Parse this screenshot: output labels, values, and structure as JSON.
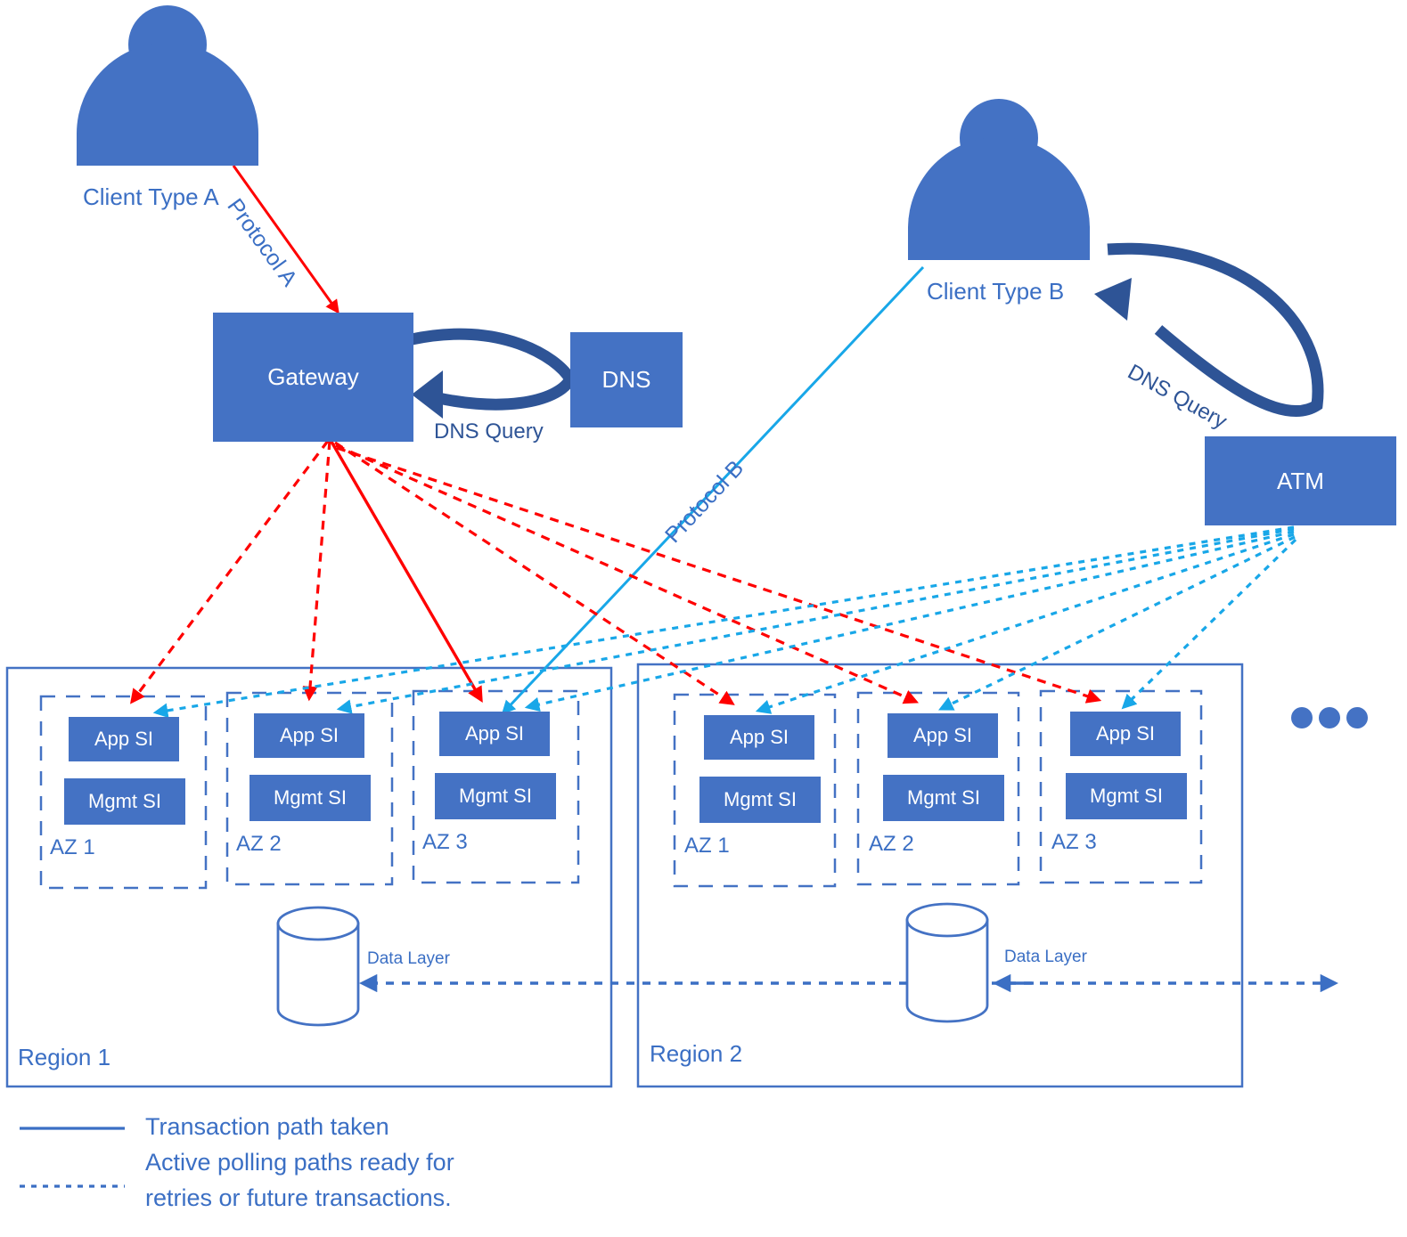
{
  "colors": {
    "brand_blue": "#4472C4",
    "label_blue": "#3B6FC4",
    "navy": "#2E5496",
    "red_path": "#FF0000",
    "cyan_path": "#18A7E8",
    "outline_blue": "#4472C4"
  },
  "actors": [
    {
      "name": "client-type-a",
      "label": "Client Type A"
    },
    {
      "name": "client-type-b",
      "label": "Client Type B"
    }
  ],
  "nodes": {
    "gateway": "Gateway",
    "dns": "DNS",
    "atm": "ATM"
  },
  "edge_labels": {
    "protocol_a": "Protocol A",
    "protocol_b": "Protocol B",
    "dns_query_gateway": "DNS Query",
    "dns_query_atm": "DNS Query",
    "data_layer_region1": "Data Layer",
    "data_layer_region2": "Data Layer"
  },
  "regions": [
    {
      "name": "region-1",
      "label": "Region 1",
      "azs": [
        {
          "label": "AZ 1",
          "app": "App SI",
          "mgmt": "Mgmt SI"
        },
        {
          "label": "AZ 2",
          "app": "App SI",
          "mgmt": "Mgmt SI"
        },
        {
          "label": "AZ 3",
          "app": "App SI",
          "mgmt": "Mgmt SI"
        }
      ]
    },
    {
      "name": "region-2",
      "label": "Region 2",
      "azs": [
        {
          "label": "AZ 1",
          "app": "App SI",
          "mgmt": "Mgmt SI"
        },
        {
          "label": "AZ 2",
          "app": "App SI",
          "mgmt": "Mgmt SI"
        },
        {
          "label": "AZ 3",
          "app": "App SI",
          "mgmt": "Mgmt SI"
        }
      ]
    }
  ],
  "more_regions_indicator": "•••",
  "legend": {
    "items": [
      {
        "style": "solid",
        "label": "Transaction path taken"
      },
      {
        "style": "dotted",
        "label": "Active polling paths ready for retries or future transactions."
      }
    ],
    "line2_a": "Active polling paths ready for",
    "line2_b": "retries or future transactions."
  }
}
